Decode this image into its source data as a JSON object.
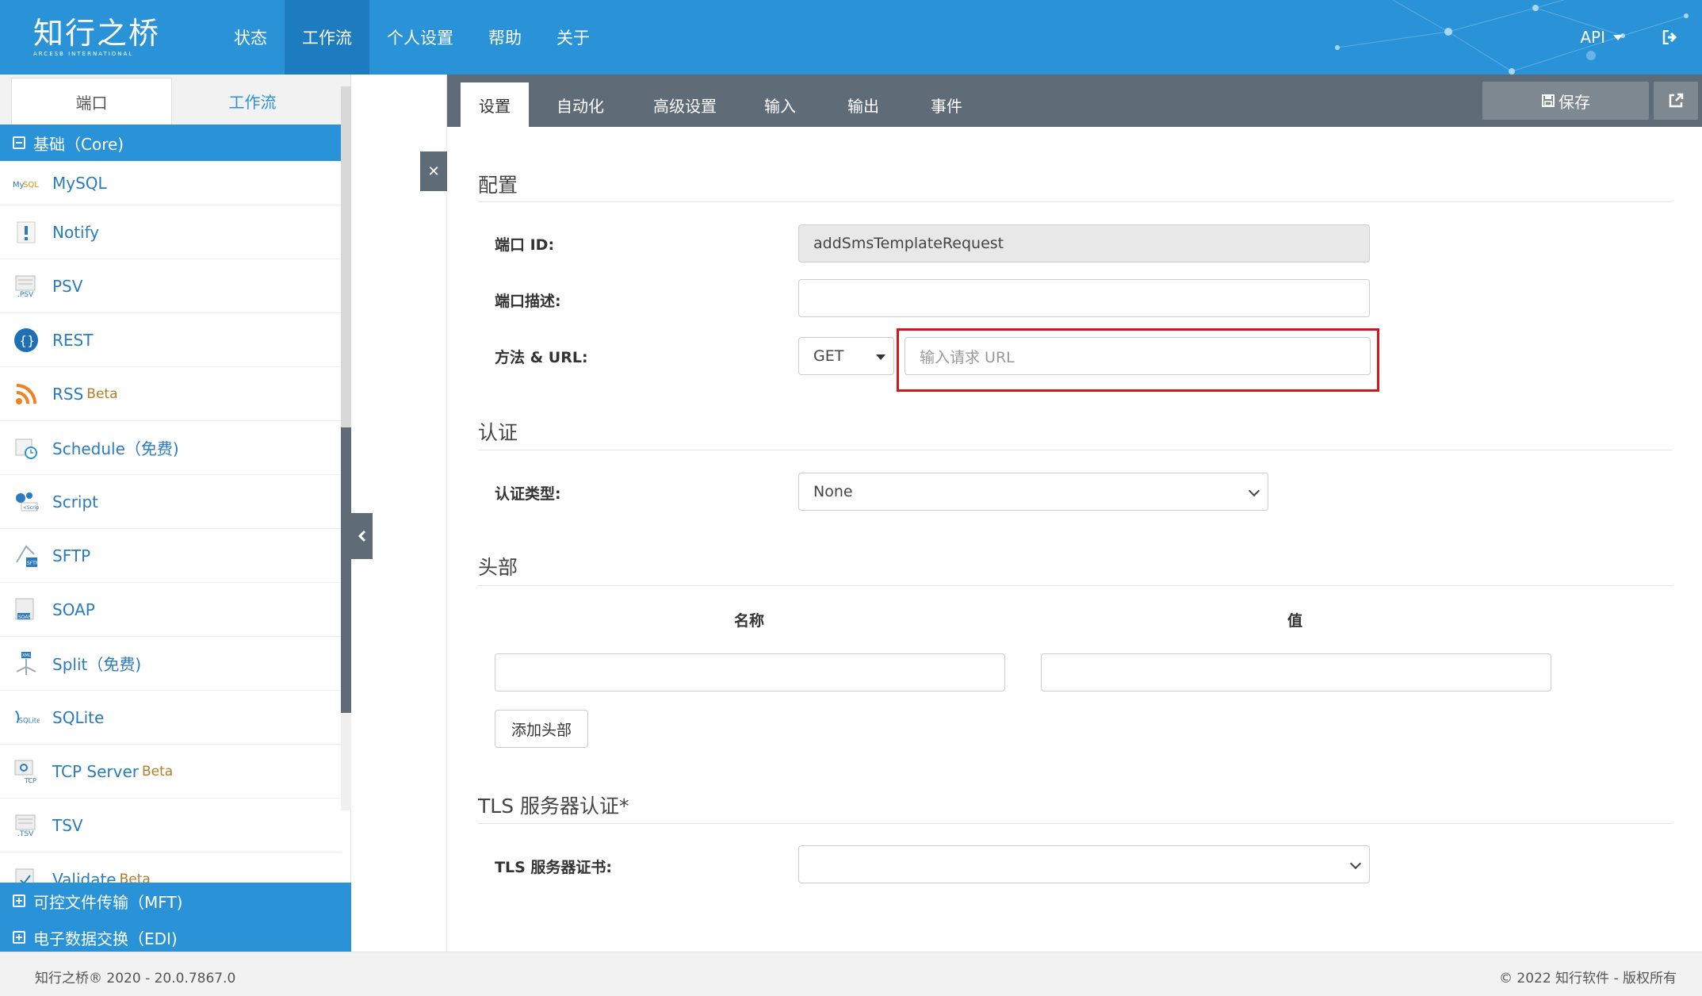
{
  "brand": {
    "name_cn": "知行之桥",
    "name_en": "ARCESB INTERNATIONAL"
  },
  "nav": [
    "状态",
    "工作流",
    "个人设置",
    "帮助",
    "关于"
  ],
  "nav_active": "工作流",
  "top_right": {
    "api_label": "API",
    "logout_icon": "sign-out-icon"
  },
  "sidebar": {
    "tabs": [
      "端口",
      "工作流"
    ],
    "core_group": "基础（Core)",
    "items": [
      {
        "label": "MySQL",
        "badge": "",
        "icon": "mysql-icon"
      },
      {
        "label": "Notify",
        "badge": "",
        "icon": "notify-icon"
      },
      {
        "label": "PSV",
        "badge": "",
        "icon": "psv-file-icon"
      },
      {
        "label": "REST",
        "badge": "",
        "icon": "rest-icon"
      },
      {
        "label": "RSS",
        "badge": "Beta",
        "icon": "rss-icon"
      },
      {
        "label": "Schedule（免费)",
        "badge": "",
        "icon": "schedule-icon"
      },
      {
        "label": "Script",
        "badge": "",
        "icon": "script-icon"
      },
      {
        "label": "SFTP",
        "badge": "",
        "icon": "sftp-icon"
      },
      {
        "label": "SOAP",
        "badge": "",
        "icon": "soap-icon"
      },
      {
        "label": "Split（免费)",
        "badge": "",
        "icon": "split-icon"
      },
      {
        "label": "SQLite",
        "badge": "",
        "icon": "sqlite-icon"
      },
      {
        "label": "TCP Server",
        "badge": "Beta",
        "icon": "tcp-server-icon"
      },
      {
        "label": "TSV",
        "badge": "",
        "icon": "tsv-file-icon"
      },
      {
        "label": "Validate",
        "badge": "Beta",
        "icon": "validate-icon"
      }
    ],
    "mft_group": "可控文件传输（MFT)",
    "edi_group": "电子数据交换（EDI)"
  },
  "main": {
    "tabs": [
      "设置",
      "自动化",
      "高级设置",
      "输入",
      "输出",
      "事件"
    ],
    "active_tab": "设置",
    "save_label": "保存",
    "config": {
      "title": "配置",
      "port_id_label": "端口 ID:",
      "port_id_value": "addSmsTemplateRequest",
      "desc_label": "端口描述:",
      "desc_value": "",
      "method_label": "方法 & URL:",
      "method_value": "GET",
      "url_placeholder": "输入请求 URL"
    },
    "auth": {
      "title": "认证",
      "type_label": "认证类型:",
      "type_value": "None"
    },
    "headers": {
      "title": "头部",
      "name_col": "名称",
      "value_col": "值",
      "add_label": "添加头部"
    },
    "tls": {
      "title": "TLS 服务器认证*",
      "cert_label": "TLS 服务器证书:",
      "cert_value": ""
    }
  },
  "footer": {
    "left": "知行之桥® 2020 - 20.0.7867.0",
    "right": "© 2022 知行软件 - 版权所有"
  },
  "colors": {
    "primary": "#2a93d8",
    "nav_active": "#1c7cbf",
    "tab_bar": "#5f6b76",
    "highlight": "#d7141a",
    "beta": "#b07d2b"
  }
}
